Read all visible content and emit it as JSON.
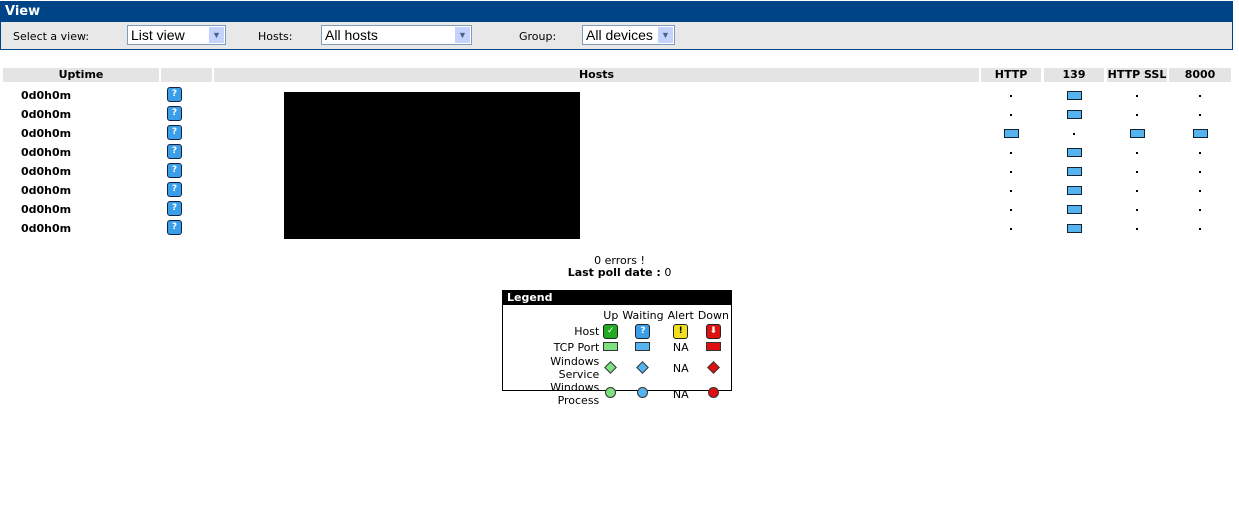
{
  "title": "View",
  "filters": {
    "view_label": "Select a view:",
    "view_value": "List view",
    "hosts_label": "Hosts:",
    "hosts_value": "All hosts",
    "group_label": "Group:",
    "group_value": "All devices"
  },
  "columns": [
    "Uptime",
    "",
    "Hosts",
    "HTTP",
    "139",
    "HTTP SSL",
    "8000"
  ],
  "rows": [
    {
      "uptime": "0d0h0m",
      "status": "waiting",
      "ports": [
        "none",
        "waiting",
        "none",
        "none"
      ]
    },
    {
      "uptime": "0d0h0m",
      "status": "waiting",
      "ports": [
        "none",
        "waiting",
        "none",
        "none"
      ]
    },
    {
      "uptime": "0d0h0m",
      "status": "waiting",
      "ports": [
        "waiting",
        "none",
        "waiting",
        "waiting"
      ]
    },
    {
      "uptime": "0d0h0m",
      "status": "waiting",
      "ports": [
        "none",
        "waiting",
        "none",
        "none"
      ]
    },
    {
      "uptime": "0d0h0m",
      "status": "waiting",
      "ports": [
        "none",
        "waiting",
        "none",
        "none"
      ]
    },
    {
      "uptime": "0d0h0m",
      "status": "waiting",
      "ports": [
        "none",
        "waiting",
        "none",
        "none"
      ]
    },
    {
      "uptime": "0d0h0m",
      "status": "waiting",
      "ports": [
        "none",
        "waiting",
        "none",
        "none"
      ]
    },
    {
      "uptime": "0d0h0m",
      "status": "waiting",
      "ports": [
        "none",
        "waiting",
        "none",
        "none"
      ]
    }
  ],
  "summary": {
    "errors": "0 errors !",
    "poll_label": "Last poll date :",
    "poll_value": "0"
  },
  "legend": {
    "title": "Legend",
    "states": [
      "Up",
      "Waiting",
      "Alert",
      "Down"
    ],
    "rows": [
      {
        "label": "Host",
        "kind": "host"
      },
      {
        "label": "TCP Port",
        "kind": "rect"
      },
      {
        "label": "Windows Service",
        "kind": "dia"
      },
      {
        "label": "Windows Process",
        "kind": "circ"
      }
    ],
    "na": "NA",
    "colors": {
      "up": "#7ee07e",
      "waiting": "#55b4f0",
      "alert": "#f0e020",
      "down": "#e01010",
      "host_up": "#22aa22",
      "host_waiting": "#3a9ee8"
    }
  }
}
